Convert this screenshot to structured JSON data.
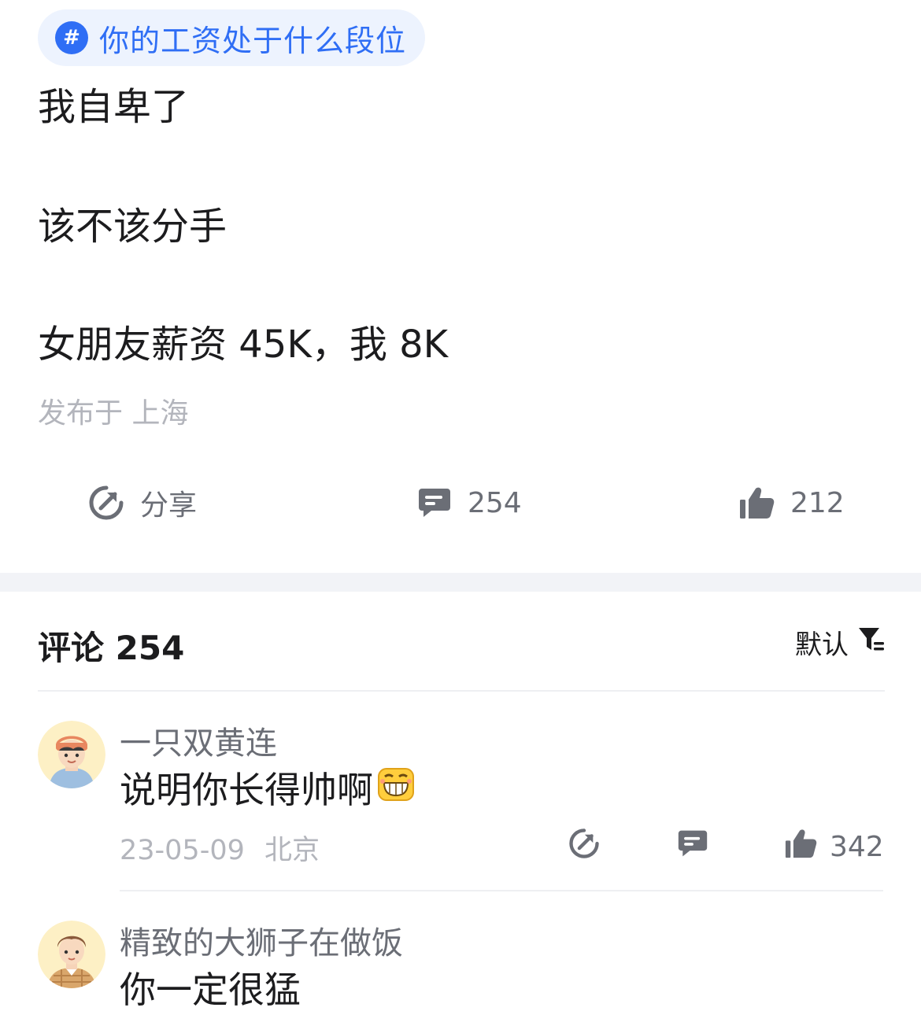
{
  "topic": {
    "hash_symbol": "#",
    "label": "你的工资处于什么段位"
  },
  "post": {
    "lines": [
      "我自卑了",
      "该不该分手",
      "女朋友薪资 45K，我 8K"
    ],
    "location": "发布于 上海",
    "actions": {
      "share_label": "分享",
      "comment_count": "254",
      "like_count": "212"
    }
  },
  "comments_section": {
    "title": "评论 254",
    "sort_label": "默认"
  },
  "comments": [
    {
      "username": "一只双黄连",
      "text": "说明你长得帅啊",
      "emoji_icon": "grinning-emoji-icon",
      "date": "23-05-09",
      "location": "北京",
      "like_count": "342"
    },
    {
      "username": "精致的大狮子在做饭",
      "text": "你一定很猛"
    }
  ],
  "colors": {
    "accent": "#2f6ef5",
    "tag_bg": "#edf3fe",
    "muted_text": "#b3b5bc",
    "icon_gray": "#6b6e76",
    "section_band": "#f2f3f7"
  }
}
